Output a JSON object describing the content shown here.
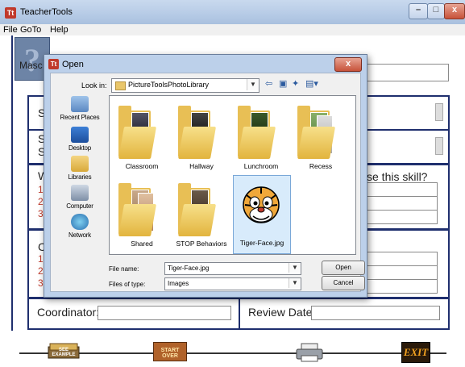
{
  "window": {
    "title": "TeacherTools",
    "icon": "teachertools-app-icon"
  },
  "menu": {
    "items": [
      "File",
      "GoTo",
      "Help"
    ]
  },
  "form": {
    "top_label": "Masc",
    "skill_prompt": "se this skill?",
    "left_letters": [
      "S",
      "S",
      "S",
      "W",
      "C"
    ],
    "numbers_a": [
      "1",
      "2",
      "3"
    ],
    "numbers_b": [
      "1",
      "2",
      "3"
    ],
    "coordinator_label": "Coordinator:",
    "review_date_label": "Review Date:"
  },
  "bottom_buttons": {
    "see_example": "SEE EXAMPLE",
    "start_over": "START OVER",
    "print_icon": "printer-icon",
    "exit": "EXIT"
  },
  "dialog": {
    "title": "Open",
    "look_in_label": "Look in:",
    "look_in_value": "PictureToolsPhotoLibrary",
    "places": [
      "Recent Places",
      "Desktop",
      "Libraries",
      "Computer",
      "Network"
    ],
    "files": [
      {
        "name": "Classroom",
        "type": "folder"
      },
      {
        "name": "Hallway",
        "type": "folder"
      },
      {
        "name": "Lunchroom",
        "type": "folder"
      },
      {
        "name": "Recess",
        "type": "folder"
      },
      {
        "name": "Shared",
        "type": "folder"
      },
      {
        "name": "STOP Behaviors",
        "type": "folder"
      },
      {
        "name": "Tiger-Face.jpg",
        "type": "image",
        "selected": true
      }
    ],
    "file_name_label": "File name:",
    "file_name_value": "Tiger-Face.jpg",
    "file_type_label": "Files of type:",
    "file_type_value": "Images",
    "open_button": "Open",
    "cancel_button": "Cancel"
  },
  "colors": {
    "form_border": "#1f2f6e",
    "accent_red": "#c0392b",
    "folder": "#e8bf55"
  }
}
